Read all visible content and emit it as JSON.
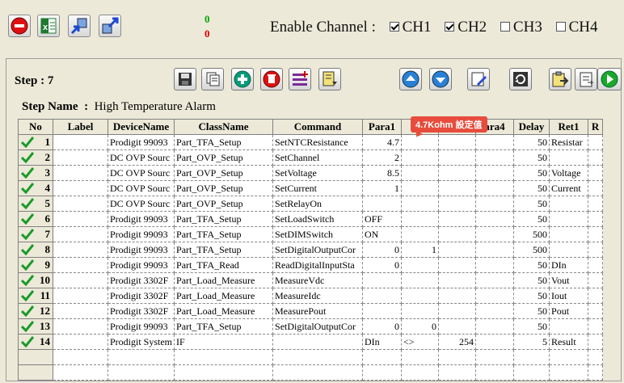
{
  "toolbar": {
    "counter_green": "0",
    "counter_red": "0",
    "enable_channel_label": "Enable Channel :",
    "channels": [
      {
        "label": "CH1",
        "checked": true
      },
      {
        "label": "CH2",
        "checked": true
      },
      {
        "label": "CH3",
        "checked": false
      },
      {
        "label": "CH4",
        "checked": false
      }
    ]
  },
  "step": {
    "label": "Step : 7",
    "name_label": "Step Name",
    "name_sep": ":",
    "name_value": "High Temperature Alarm"
  },
  "callout": "4.7Kohm 設定值",
  "table": {
    "headers": [
      "No",
      "Label",
      "DeviceName",
      "ClassName",
      "Command",
      "Para1",
      "",
      "",
      "ara4",
      "Delay",
      "Ret1",
      "R"
    ],
    "rows": [
      {
        "no": "1",
        "label": "",
        "device": "Prodigit 99093",
        "class": "Part_TFA_Setup",
        "command": "SetNTCResistance",
        "p1": "4.7",
        "p2": "",
        "p3": "",
        "p4": "",
        "delay": "50",
        "ret1": "Resistar"
      },
      {
        "no": "2",
        "label": "",
        "device": "DC OVP Sourc",
        "class": "Part_OVP_Setup",
        "command": "SetChannel",
        "p1": "2",
        "p2": "",
        "p3": "",
        "p4": "",
        "delay": "50",
        "ret1": ""
      },
      {
        "no": "3",
        "label": "",
        "device": "DC OVP Sourc",
        "class": "Part_OVP_Setup",
        "command": "SetVoltage",
        "p1": "8.5",
        "p2": "",
        "p3": "",
        "p4": "",
        "delay": "50",
        "ret1": "Voltage"
      },
      {
        "no": "4",
        "label": "",
        "device": "DC OVP Sourc",
        "class": "Part_OVP_Setup",
        "command": "SetCurrent",
        "p1": "1",
        "p2": "",
        "p3": "",
        "p4": "",
        "delay": "50",
        "ret1": "Current"
      },
      {
        "no": "5",
        "label": "",
        "device": "DC OVP Sourc",
        "class": "Part_OVP_Setup",
        "command": "SetRelayOn",
        "p1": "",
        "p2": "",
        "p3": "",
        "p4": "",
        "delay": "50",
        "ret1": ""
      },
      {
        "no": "6",
        "label": "",
        "device": "Prodigit 99093",
        "class": "Part_TFA_Setup",
        "command": "SetLoadSwitch",
        "p1": "OFF",
        "p2": "",
        "p3": "",
        "p4": "",
        "delay": "50",
        "ret1": ""
      },
      {
        "no": "7",
        "label": "",
        "device": "Prodigit 99093",
        "class": "Part_TFA_Setup",
        "command": "SetDIMSwitch",
        "p1": "ON",
        "p2": "",
        "p3": "",
        "p4": "",
        "delay": "500",
        "ret1": ""
      },
      {
        "no": "8",
        "label": "",
        "device": "Prodigit 99093",
        "class": "Part_TFA_Setup",
        "command": "SetDigitalOutputCor",
        "p1": "0",
        "p2": "1",
        "p3": "",
        "p4": "",
        "delay": "500",
        "ret1": ""
      },
      {
        "no": "9",
        "label": "",
        "device": "Prodigit 99093",
        "class": "Part_TFA_Read",
        "command": "ReadDigitalInputSta",
        "p1": "0",
        "p2": "",
        "p3": "",
        "p4": "",
        "delay": "50",
        "ret1": "DIn"
      },
      {
        "no": "10",
        "label": "",
        "device": "Prodigit 3302F",
        "class": "Part_Load_Measure",
        "command": "MeasureVdc",
        "p1": "",
        "p2": "",
        "p3": "",
        "p4": "",
        "delay": "50",
        "ret1": "Vout"
      },
      {
        "no": "11",
        "label": "",
        "device": "Prodigit 3302F",
        "class": "Part_Load_Measure",
        "command": "MeasureIdc",
        "p1": "",
        "p2": "",
        "p3": "",
        "p4": "",
        "delay": "50",
        "ret1": "Iout"
      },
      {
        "no": "12",
        "label": "",
        "device": "Prodigit 3302F",
        "class": "Part_Load_Measure",
        "command": "MeasurePout",
        "p1": "",
        "p2": "",
        "p3": "",
        "p4": "",
        "delay": "50",
        "ret1": "Pout"
      },
      {
        "no": "13",
        "label": "",
        "device": "Prodigit 99093",
        "class": "Part_TFA_Setup",
        "command": "SetDigitalOutputCor",
        "p1": "0",
        "p2": "0",
        "p3": "",
        "p4": "",
        "delay": "50",
        "ret1": ""
      },
      {
        "no": "14",
        "label": "",
        "device": "Prodigit System",
        "class": "IF",
        "command": "",
        "p1": "DIn",
        "p2": "<>",
        "p3": "254",
        "p4": "",
        "delay": "5",
        "ret1": "Result"
      }
    ]
  }
}
